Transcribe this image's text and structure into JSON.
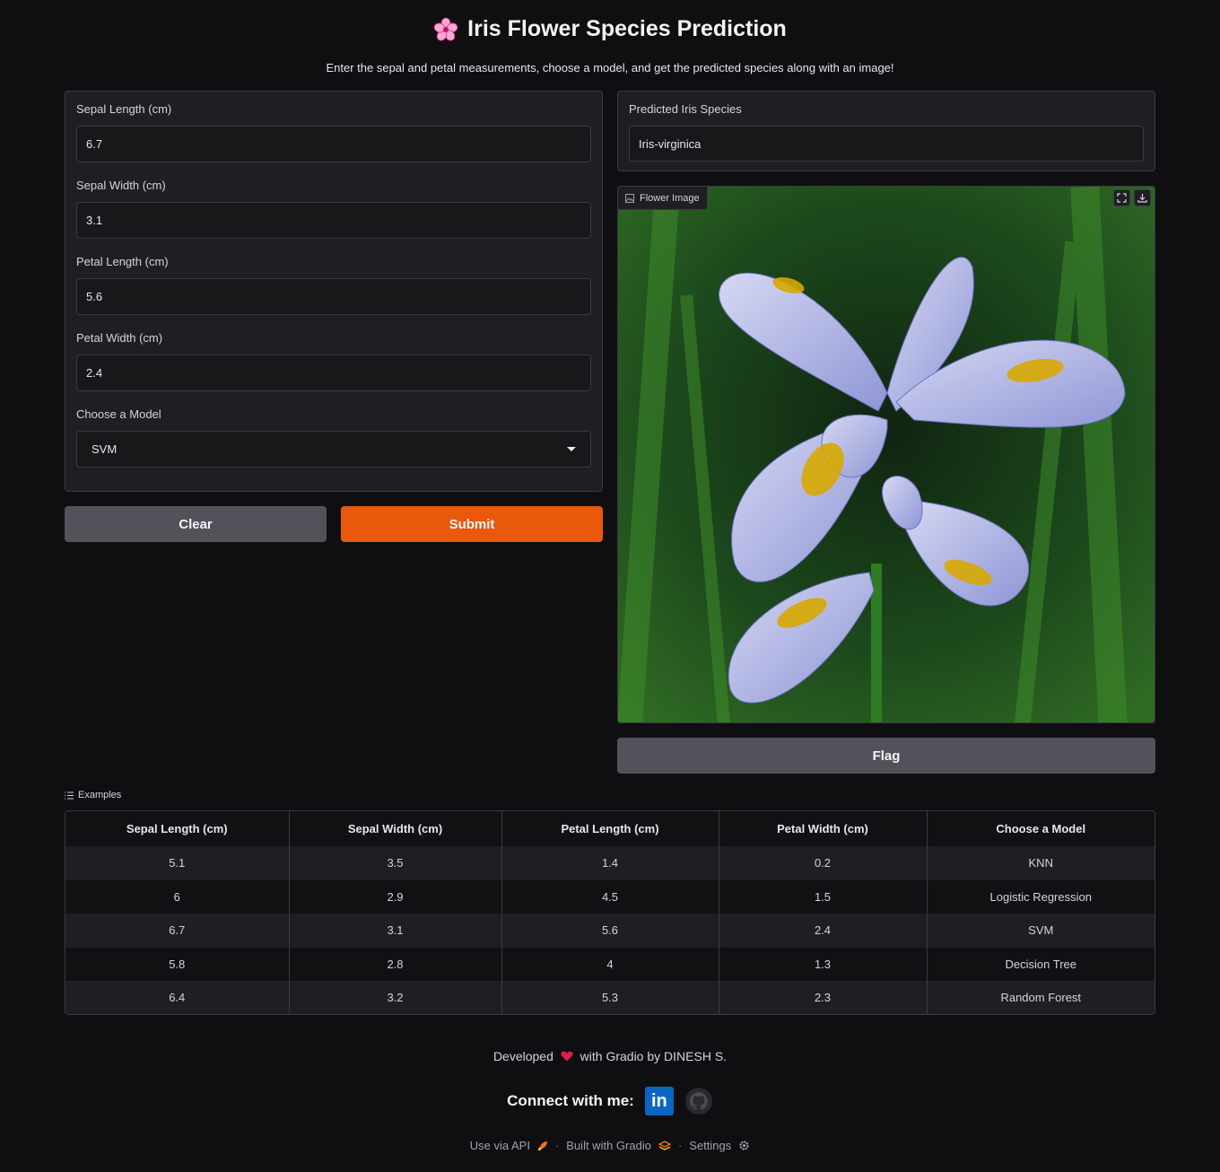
{
  "header": {
    "title": "Iris Flower Species Prediction",
    "subtitle": "Enter the sepal and petal measurements, choose a model, and get the predicted species along with an image!"
  },
  "inputs": {
    "sepal_length": {
      "label": "Sepal Length (cm)",
      "value": "6.7"
    },
    "sepal_width": {
      "label": "Sepal Width (cm)",
      "value": "3.1"
    },
    "petal_length": {
      "label": "Petal Length (cm)",
      "value": "5.6"
    },
    "petal_width": {
      "label": "Petal Width (cm)",
      "value": "2.4"
    },
    "model": {
      "label": "Choose a Model",
      "value": "SVM"
    }
  },
  "buttons": {
    "clear": "Clear",
    "submit": "Submit",
    "flag": "Flag"
  },
  "output": {
    "label": "Predicted Iris Species",
    "value": "Iris-virginica",
    "image_label": "Flower Image"
  },
  "examples": {
    "label": "Examples",
    "headers": [
      "Sepal Length (cm)",
      "Sepal Width (cm)",
      "Petal Length (cm)",
      "Petal Width (cm)",
      "Choose a Model"
    ],
    "rows": [
      [
        "5.1",
        "3.5",
        "1.4",
        "0.2",
        "KNN"
      ],
      [
        "6",
        "2.9",
        "4.5",
        "1.5",
        "Logistic Regression"
      ],
      [
        "6.7",
        "3.1",
        "5.6",
        "2.4",
        "SVM"
      ],
      [
        "5.8",
        "2.8",
        "4",
        "1.3",
        "Decision Tree"
      ],
      [
        "6.4",
        "3.2",
        "5.3",
        "2.3",
        "Random Forest"
      ]
    ]
  },
  "footer": {
    "developed_before": "Developed",
    "developed_after": "with Gradio by DINESH S.",
    "connect": "Connect with me:",
    "use_api": "Use via API",
    "built_with": "Built with Gradio",
    "settings": "Settings"
  },
  "colors": {
    "accent": "#ea580c",
    "background": "#0f0f11",
    "panel": "#1f1f23"
  }
}
